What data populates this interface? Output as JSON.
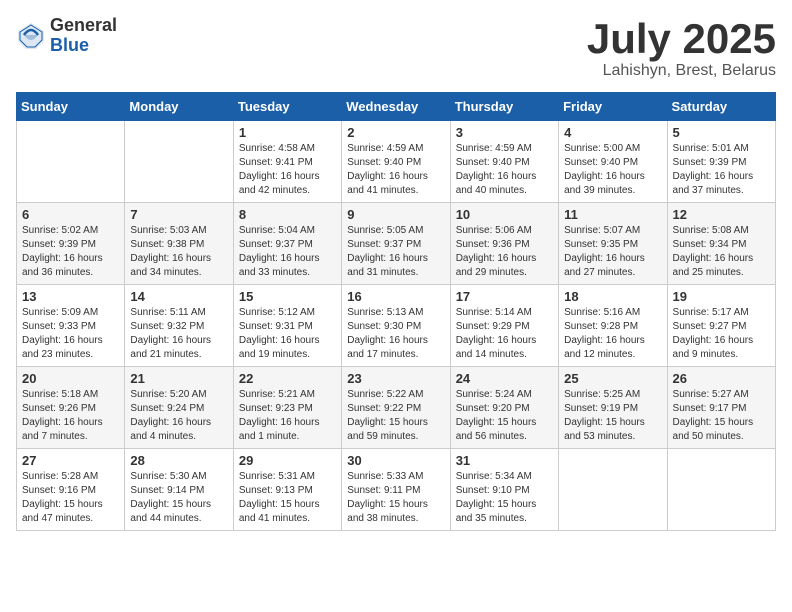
{
  "header": {
    "logo_general": "General",
    "logo_blue": "Blue",
    "month_title": "July 2025",
    "location": "Lahishyn, Brest, Belarus"
  },
  "weekdays": [
    "Sunday",
    "Monday",
    "Tuesday",
    "Wednesday",
    "Thursday",
    "Friday",
    "Saturday"
  ],
  "weeks": [
    [
      {
        "day": "",
        "info": ""
      },
      {
        "day": "",
        "info": ""
      },
      {
        "day": "1",
        "info": "Sunrise: 4:58 AM\nSunset: 9:41 PM\nDaylight: 16 hours\nand 42 minutes."
      },
      {
        "day": "2",
        "info": "Sunrise: 4:59 AM\nSunset: 9:40 PM\nDaylight: 16 hours\nand 41 minutes."
      },
      {
        "day": "3",
        "info": "Sunrise: 4:59 AM\nSunset: 9:40 PM\nDaylight: 16 hours\nand 40 minutes."
      },
      {
        "day": "4",
        "info": "Sunrise: 5:00 AM\nSunset: 9:40 PM\nDaylight: 16 hours\nand 39 minutes."
      },
      {
        "day": "5",
        "info": "Sunrise: 5:01 AM\nSunset: 9:39 PM\nDaylight: 16 hours\nand 37 minutes."
      }
    ],
    [
      {
        "day": "6",
        "info": "Sunrise: 5:02 AM\nSunset: 9:39 PM\nDaylight: 16 hours\nand 36 minutes."
      },
      {
        "day": "7",
        "info": "Sunrise: 5:03 AM\nSunset: 9:38 PM\nDaylight: 16 hours\nand 34 minutes."
      },
      {
        "day": "8",
        "info": "Sunrise: 5:04 AM\nSunset: 9:37 PM\nDaylight: 16 hours\nand 33 minutes."
      },
      {
        "day": "9",
        "info": "Sunrise: 5:05 AM\nSunset: 9:37 PM\nDaylight: 16 hours\nand 31 minutes."
      },
      {
        "day": "10",
        "info": "Sunrise: 5:06 AM\nSunset: 9:36 PM\nDaylight: 16 hours\nand 29 minutes."
      },
      {
        "day": "11",
        "info": "Sunrise: 5:07 AM\nSunset: 9:35 PM\nDaylight: 16 hours\nand 27 minutes."
      },
      {
        "day": "12",
        "info": "Sunrise: 5:08 AM\nSunset: 9:34 PM\nDaylight: 16 hours\nand 25 minutes."
      }
    ],
    [
      {
        "day": "13",
        "info": "Sunrise: 5:09 AM\nSunset: 9:33 PM\nDaylight: 16 hours\nand 23 minutes."
      },
      {
        "day": "14",
        "info": "Sunrise: 5:11 AM\nSunset: 9:32 PM\nDaylight: 16 hours\nand 21 minutes."
      },
      {
        "day": "15",
        "info": "Sunrise: 5:12 AM\nSunset: 9:31 PM\nDaylight: 16 hours\nand 19 minutes."
      },
      {
        "day": "16",
        "info": "Sunrise: 5:13 AM\nSunset: 9:30 PM\nDaylight: 16 hours\nand 17 minutes."
      },
      {
        "day": "17",
        "info": "Sunrise: 5:14 AM\nSunset: 9:29 PM\nDaylight: 16 hours\nand 14 minutes."
      },
      {
        "day": "18",
        "info": "Sunrise: 5:16 AM\nSunset: 9:28 PM\nDaylight: 16 hours\nand 12 minutes."
      },
      {
        "day": "19",
        "info": "Sunrise: 5:17 AM\nSunset: 9:27 PM\nDaylight: 16 hours\nand 9 minutes."
      }
    ],
    [
      {
        "day": "20",
        "info": "Sunrise: 5:18 AM\nSunset: 9:26 PM\nDaylight: 16 hours\nand 7 minutes."
      },
      {
        "day": "21",
        "info": "Sunrise: 5:20 AM\nSunset: 9:24 PM\nDaylight: 16 hours\nand 4 minutes."
      },
      {
        "day": "22",
        "info": "Sunrise: 5:21 AM\nSunset: 9:23 PM\nDaylight: 16 hours\nand 1 minute."
      },
      {
        "day": "23",
        "info": "Sunrise: 5:22 AM\nSunset: 9:22 PM\nDaylight: 15 hours\nand 59 minutes."
      },
      {
        "day": "24",
        "info": "Sunrise: 5:24 AM\nSunset: 9:20 PM\nDaylight: 15 hours\nand 56 minutes."
      },
      {
        "day": "25",
        "info": "Sunrise: 5:25 AM\nSunset: 9:19 PM\nDaylight: 15 hours\nand 53 minutes."
      },
      {
        "day": "26",
        "info": "Sunrise: 5:27 AM\nSunset: 9:17 PM\nDaylight: 15 hours\nand 50 minutes."
      }
    ],
    [
      {
        "day": "27",
        "info": "Sunrise: 5:28 AM\nSunset: 9:16 PM\nDaylight: 15 hours\nand 47 minutes."
      },
      {
        "day": "28",
        "info": "Sunrise: 5:30 AM\nSunset: 9:14 PM\nDaylight: 15 hours\nand 44 minutes."
      },
      {
        "day": "29",
        "info": "Sunrise: 5:31 AM\nSunset: 9:13 PM\nDaylight: 15 hours\nand 41 minutes."
      },
      {
        "day": "30",
        "info": "Sunrise: 5:33 AM\nSunset: 9:11 PM\nDaylight: 15 hours\nand 38 minutes."
      },
      {
        "day": "31",
        "info": "Sunrise: 5:34 AM\nSunset: 9:10 PM\nDaylight: 15 hours\nand 35 minutes."
      },
      {
        "day": "",
        "info": ""
      },
      {
        "day": "",
        "info": ""
      }
    ]
  ]
}
